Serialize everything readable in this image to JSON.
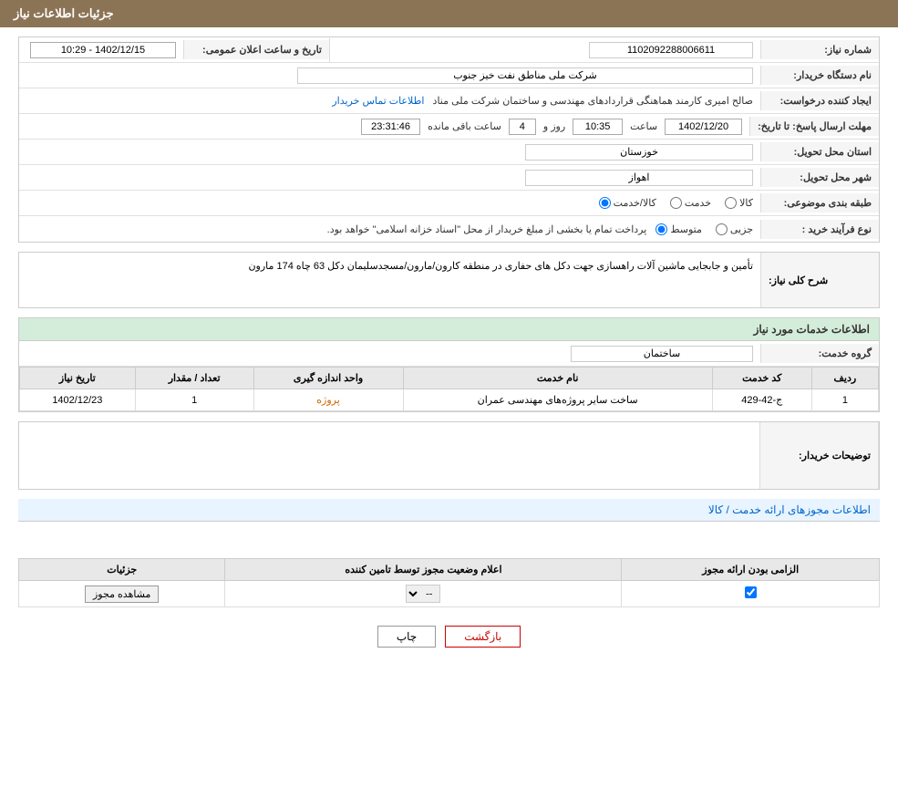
{
  "page": {
    "title": "جزئیات اطلاعات نیاز"
  },
  "header": {
    "label": "جزئیات اطلاعات نیاز"
  },
  "fields": {
    "shomareNiaz_label": "شماره نیاز:",
    "shomareNiaz_value": "1102092288006611",
    "namDastgah_label": "نام دستگاه خریدار:",
    "namDastgah_value": "شرکت ملی مناطق نفت خیز جنوب",
    "ijadKonande_label": "ایجاد کننده درخواست:",
    "ijadKonande_value": "صالح امیری کارمند هماهنگی قراردادهای مهندسی و ساختمان شرکت ملی مناد",
    "ijadKonande_link": "اطلاعات تماس خریدار",
    "mohlat_label": "مهلت ارسال پاسخ: تا تاریخ:",
    "mohlat_date": "1402/12/20",
    "mohlat_saat_label": "ساعت",
    "mohlat_saat": "10:35",
    "mohlat_roz_label": "روز و",
    "mohlat_roz": "4",
    "mohlat_remaining_label": "ساعت باقی مانده",
    "mohlat_remaining": "23:31:46",
    "ostan_label": "استان محل تحویل:",
    "ostan_value": "خوزستان",
    "shahr_label": "شهر محل تحویل:",
    "shahr_value": "اهواز",
    "tabaqe_label": "طبقه بندی موضوعی:",
    "tabaqe_options": [
      "کالا",
      "خدمت",
      "کالا/خدمت"
    ],
    "tabaqe_selected": "کالا/خدمت",
    "noeFarayand_label": "نوع فرآیند خرید :",
    "noeFarayand_options": [
      "جزیی",
      "متوسط"
    ],
    "noeFarayand_selected": "متوسط",
    "noeFarayand_desc": "پرداخت تمام یا بخشی از مبلغ خریدار از محل \"اسناد خزانه اسلامی\" خواهد بود.",
    "taarikh_va_saat_label": "تاریخ و ساعت اعلان عمومی:",
    "taarikh_va_saat_value": "1402/12/15 - 10:29"
  },
  "sharh": {
    "section_title": "شرح کلی نیاز:",
    "text": "تأمین و جابجایی ماشین آلات راهسازی جهت دکل های حفاری در منطقه کارون/مارون/مسجدسلیمان دکل 63 چاه 174 مارون"
  },
  "khadamat": {
    "section_title": "اطلاعات خدمات مورد نیاز",
    "grooh_label": "گروه خدمت:",
    "grooh_value": "ساختمان",
    "table_headers": [
      "ردیف",
      "کد خدمت",
      "نام خدمت",
      "واحد اندازه گیری",
      "تعداد / مقدار",
      "تاریخ نیاز"
    ],
    "table_rows": [
      {
        "radif": "1",
        "kod": "ج-42-429",
        "nam": "ساخت سایر پروژه‌های مهندسی عمران",
        "vahed": "پروژه",
        "tedad": "1",
        "tarikh": "1402/12/23"
      }
    ]
  },
  "toseef": {
    "label": "توضیحات خریدار:",
    "value": ""
  },
  "mojozha": {
    "section_title": "اطلاعات مجوزهای ارائه خدمت / کالا",
    "table_headers": [
      "الزامی بودن ارائه مجوز",
      "اعلام وضعیت مجوز توسط تامین کننده",
      "جزئیات"
    ],
    "table_rows": [
      {
        "elzami": true,
        "vaziat": "--",
        "joziat": "مشاهده مجوز"
      }
    ]
  },
  "buttons": {
    "print": "چاپ",
    "back": "بازگشت"
  }
}
